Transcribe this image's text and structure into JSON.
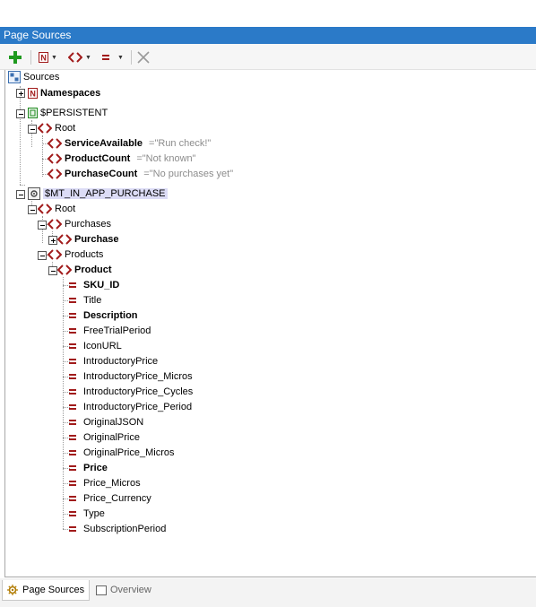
{
  "window": {
    "title": "Page Sources"
  },
  "toolbar": {
    "add_icon": "plus-icon",
    "namespace_icon": "namespace-icon",
    "element_icon": "element-icon",
    "attribute_icon": "attribute-icon",
    "delete_icon": "delete-x-icon"
  },
  "tree": {
    "root_label": "Sources",
    "namespaces_label": "Namespaces",
    "persistent": {
      "label": "$PERSISTENT",
      "root_label": "Root",
      "items": [
        {
          "name": "ServiceAvailable",
          "value": "=\"Run check!\""
        },
        {
          "name": "ProductCount",
          "value": "=\"Not known\""
        },
        {
          "name": "PurchaseCount",
          "value": "=\"No purchases yet\""
        }
      ]
    },
    "iap": {
      "label": "$MT_IN_APP_PURCHASE",
      "root_label": "Root",
      "purchases_label": "Purchases",
      "purchase_label": "Purchase",
      "products_label": "Products",
      "product_label": "Product",
      "attributes": [
        {
          "name": "SKU_ID",
          "bold": true
        },
        {
          "name": "Title",
          "bold": false
        },
        {
          "name": "Description",
          "bold": true
        },
        {
          "name": "FreeTrialPeriod",
          "bold": false
        },
        {
          "name": "IconURL",
          "bold": false
        },
        {
          "name": "IntroductoryPrice",
          "bold": false
        },
        {
          "name": "IntroductoryPrice_Micros",
          "bold": false
        },
        {
          "name": "IntroductoryPrice_Cycles",
          "bold": false
        },
        {
          "name": "IntroductoryPrice_Period",
          "bold": false
        },
        {
          "name": "OriginalJSON",
          "bold": false
        },
        {
          "name": "OriginalPrice",
          "bold": false
        },
        {
          "name": "OriginalPrice_Micros",
          "bold": false
        },
        {
          "name": "Price",
          "bold": true
        },
        {
          "name": "Price_Micros",
          "bold": false
        },
        {
          "name": "Price_Currency",
          "bold": false
        },
        {
          "name": "Type",
          "bold": false
        },
        {
          "name": "SubscriptionPeriod",
          "bold": false
        }
      ]
    }
  },
  "tabs": [
    {
      "label": "Page Sources",
      "icon": "gear-icon",
      "active": true
    },
    {
      "label": "Overview",
      "icon": "overview-icon",
      "active": false
    }
  ]
}
